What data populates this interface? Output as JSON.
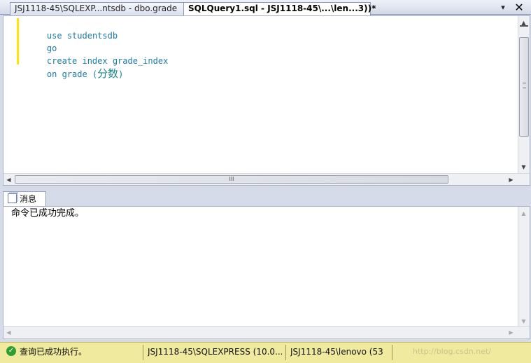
{
  "tabs": [
    {
      "label": "JSJ1118-45\\SQLEXP...ntsdb - dbo.grade"
    },
    {
      "label": "SQLQuery1.sql - JSJ1118-45\\...\\len...3))*"
    }
  ],
  "tab_controls": {
    "menu": "▾",
    "close": "✕"
  },
  "editor": {
    "lines": [
      {
        "kw": "use",
        "rest": " studentsdb"
      },
      {
        "kw": "go",
        "rest": ""
      },
      {
        "kw": "create index",
        "rest": " grade_index"
      },
      {
        "kw": "on",
        "rest": " grade (",
        "cn": "分数",
        "tail": ")"
      }
    ],
    "hscroll_grip": "III"
  },
  "results": {
    "tab_label": "消息",
    "message": "命令已成功完成。"
  },
  "status": {
    "query_state": "查询已成功执行。",
    "server": "JSJ1118-45\\SQLEXPRESS (10.0...",
    "user": "JSJ1118-45\\lenovo (53",
    "watermark": "http://blog.csdn.net/"
  },
  "colors": {
    "status_bg": "#f0ea9e",
    "keyword": "#1c7ba8",
    "margin": "#ffe600"
  }
}
